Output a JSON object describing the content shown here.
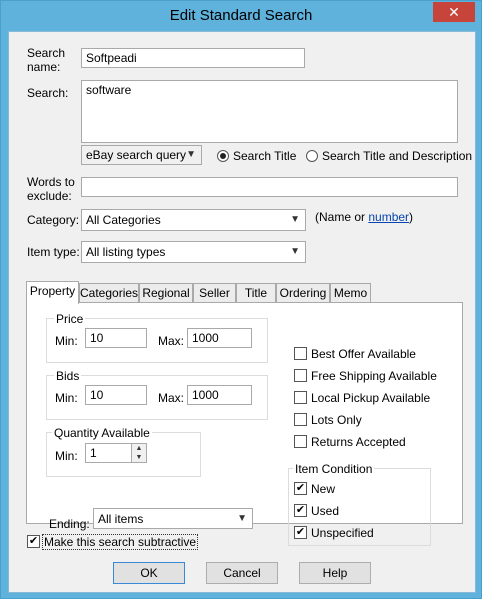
{
  "window": {
    "title": "Edit Standard Search",
    "close": "✕"
  },
  "fields": {
    "search_name_label": "Search name:",
    "search_name_value": "Softpeadi",
    "search_label": "Search:",
    "search_value": "software",
    "query_type": "eBay search query",
    "radio_title": "Search Title",
    "radio_title_desc": "Search Title and Description",
    "exclude_label": "Words to exclude:",
    "exclude_value": "",
    "category_label": "Category:",
    "category_value": "All Categories",
    "category_hint_prefix": "(Name or ",
    "category_hint_link": "number",
    "category_hint_suffix": ")",
    "item_type_label": "Item type:",
    "item_type_value": "All listing types"
  },
  "tabs": [
    "Property",
    "Categories",
    "Regional",
    "Seller",
    "Title",
    "Ordering",
    "Memo"
  ],
  "property": {
    "price_label": "Price",
    "price_min_label": "Min:",
    "price_min": "10",
    "price_max_label": "Max:",
    "price_max": "1000",
    "bids_label": "Bids",
    "bids_min_label": "Min:",
    "bids_min": "10",
    "bids_max_label": "Max:",
    "bids_max": "1000",
    "qty_label": "Quantity Available",
    "qty_min_label": "Min:",
    "qty_min": "1",
    "ending_label": "Ending:",
    "ending_value": "All items",
    "checks": [
      {
        "label": "Best Offer Available",
        "checked": false
      },
      {
        "label": "Free Shipping Available",
        "checked": false
      },
      {
        "label": "Local Pickup Available",
        "checked": false
      },
      {
        "label": "Lots Only",
        "checked": false
      },
      {
        "label": "Returns Accepted",
        "checked": false
      }
    ],
    "condition_label": "Item Condition",
    "conditions": [
      {
        "label": "New",
        "checked": true
      },
      {
        "label": "Used",
        "checked": true
      },
      {
        "label": "Unspecified",
        "checked": true
      }
    ]
  },
  "subtractive_label": "Make this search subtractive",
  "subtractive_checked": true,
  "buttons": {
    "ok": "OK",
    "cancel": "Cancel",
    "help": "Help"
  }
}
